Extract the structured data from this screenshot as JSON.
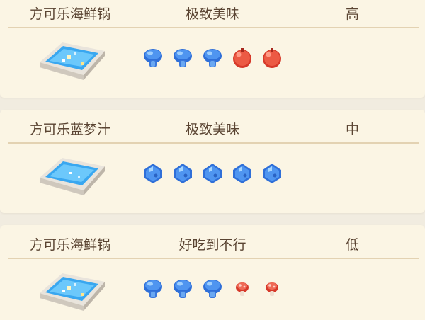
{
  "recipes": [
    {
      "name": "方可乐海鲜锅",
      "taste": "极致美味",
      "level": "高",
      "ingredients": [
        "mushroom-blue-icon",
        "mushroom-blue-icon",
        "mushroom-blue-icon",
        "berry-red-icon",
        "berry-red-icon"
      ]
    },
    {
      "name": "方可乐蓝梦汁",
      "taste": "极致美味",
      "level": "中",
      "ingredients": [
        "berry-blue-icon",
        "berry-blue-icon",
        "berry-blue-icon",
        "berry-blue-icon",
        "berry-blue-icon"
      ]
    },
    {
      "name": "方可乐海鲜锅",
      "taste": "好吃到不行",
      "level": "低",
      "ingredients": [
        "mushroom-blue-icon",
        "mushroom-blue-icon",
        "mushroom-blue-icon",
        "mushroom-red-small-icon",
        "mushroom-red-small-icon"
      ]
    }
  ],
  "colors": {
    "card_bg": "#fbf5e4",
    "page_bg": "#f1ece0",
    "text": "#5a4432",
    "divider": "#e3d2b2",
    "blue": "#3a7fe0",
    "red": "#e04a36"
  }
}
